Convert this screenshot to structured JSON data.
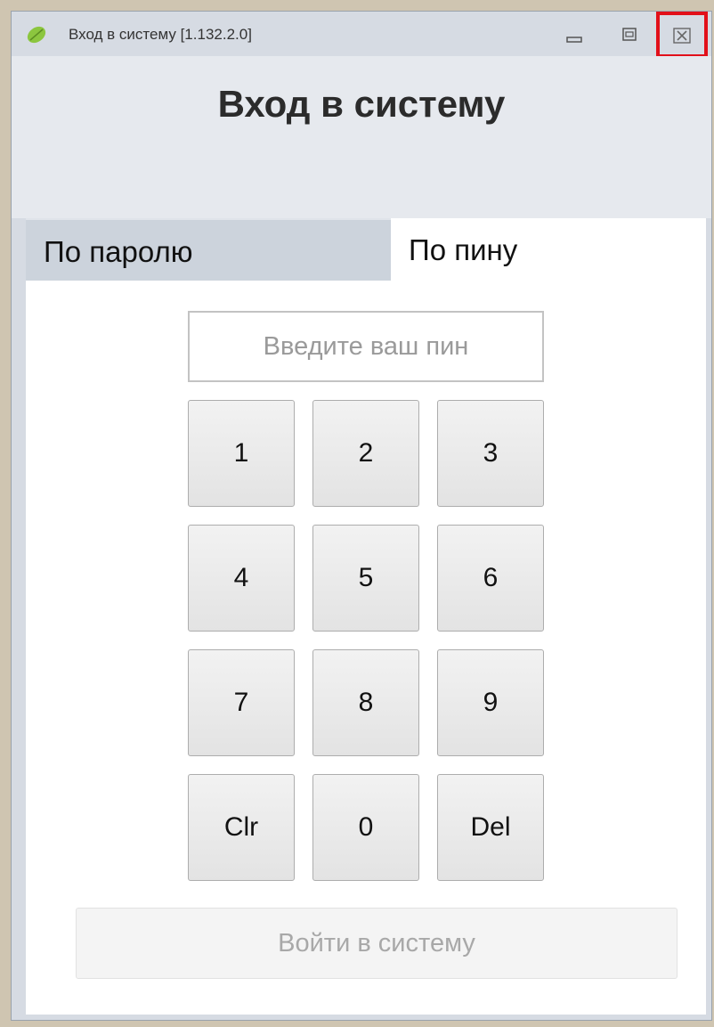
{
  "window": {
    "title": "Вход в систему [1.132.2.0]"
  },
  "header": {
    "title": "Вход в систему"
  },
  "tabs": [
    {
      "label": "По паролю",
      "selected": false
    },
    {
      "label": "По пину",
      "selected": true
    }
  ],
  "pin": {
    "value": "",
    "placeholder": "Введите ваш пин"
  },
  "keypad": {
    "keys": [
      "1",
      "2",
      "3",
      "4",
      "5",
      "6",
      "7",
      "8",
      "9",
      "Clr",
      "0",
      "Del"
    ]
  },
  "login_button": {
    "label": "Войти в систему",
    "enabled": false
  },
  "colors": {
    "accent_highlight": "#e2101a",
    "app_icon": "#8cc63f"
  }
}
